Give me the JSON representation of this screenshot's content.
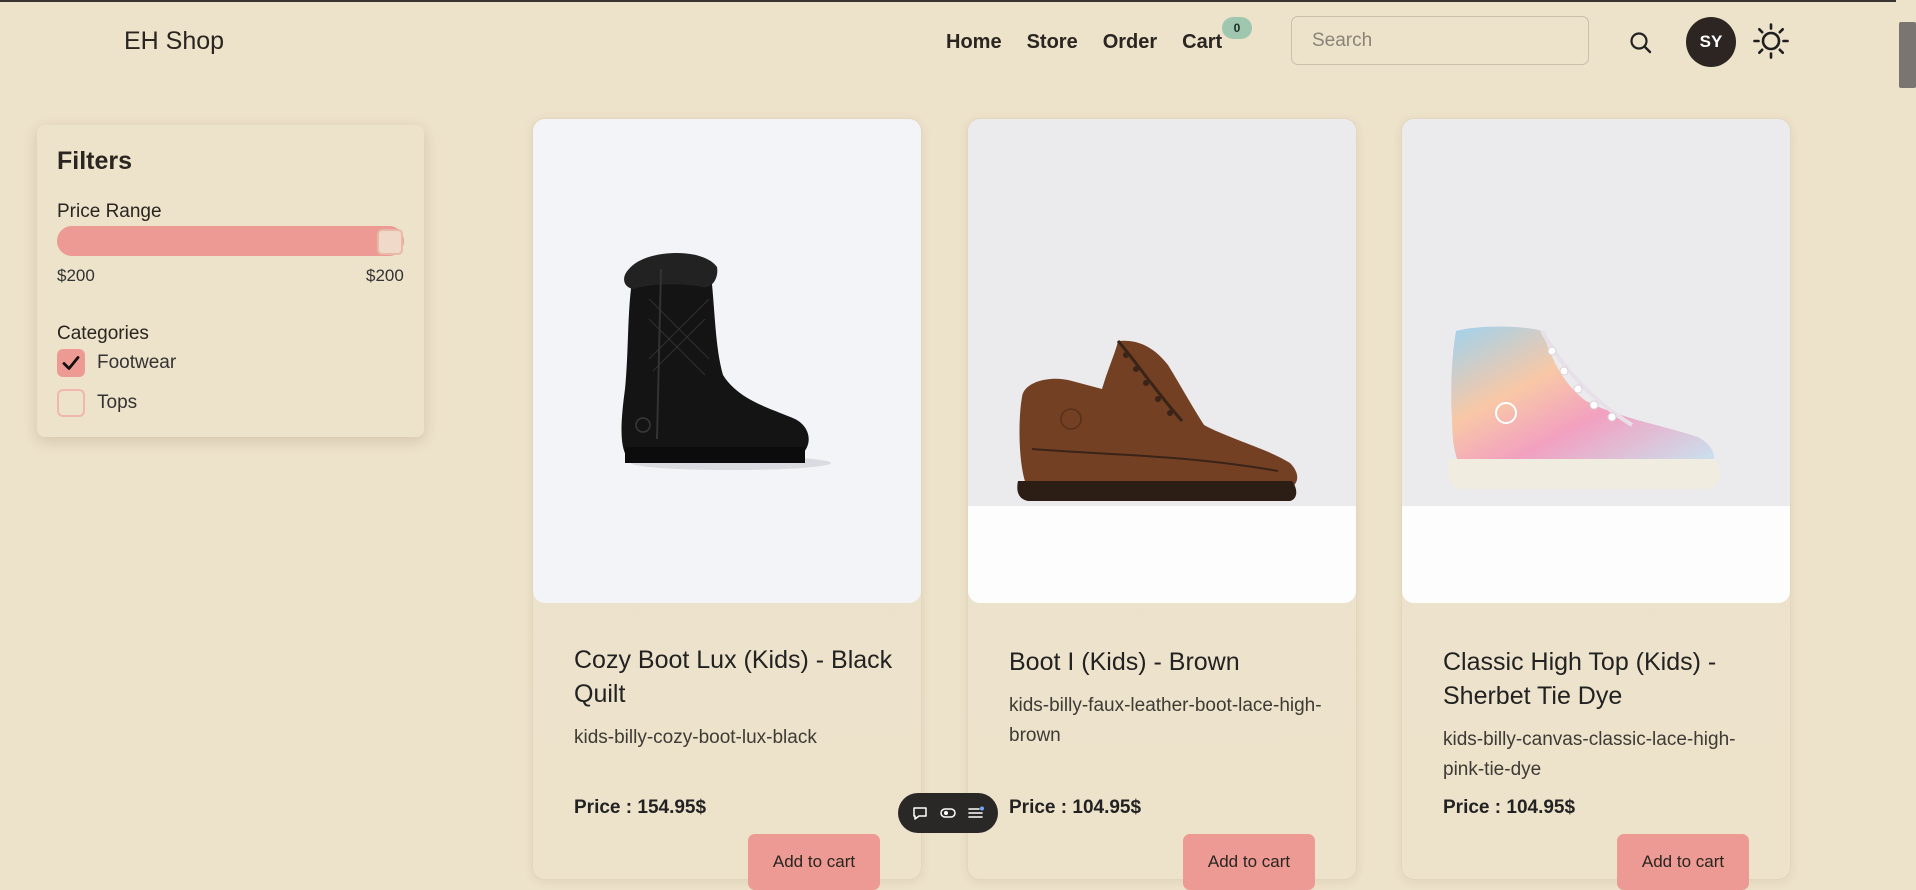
{
  "header": {
    "brand": "EH Shop",
    "nav": [
      {
        "label": "Home"
      },
      {
        "label": "Store"
      },
      {
        "label": "Order"
      },
      {
        "label": "Cart"
      }
    ],
    "cart_count": "0",
    "search_placeholder": "Search",
    "avatar_initials": "SY",
    "icons": [
      "search-icon",
      "sun-theme-icon"
    ]
  },
  "filters": {
    "title": "Filters",
    "price_range": {
      "label": "Price Range",
      "min_label": "$200",
      "max_label": "$200",
      "fill_fraction": 1.0
    },
    "categories": {
      "label": "Categories",
      "items": [
        {
          "label": "Footwear",
          "checked": true
        },
        {
          "label": "Tops",
          "checked": false
        }
      ]
    }
  },
  "products": [
    {
      "title": "Cozy Boot Lux (Kids) - Black Quilt",
      "slug": "kids-billy-cozy-boot-lux-black",
      "price_prefix": "Price : ",
      "price": "154.95$",
      "button": "Add to cart"
    },
    {
      "title": "Boot I (Kids) - Brown",
      "slug": "kids-billy-faux-leather-boot-lace-high-brown",
      "price_prefix": "Price : ",
      "price": "104.95$",
      "button": "Add to cart"
    },
    {
      "title": "Classic High Top (Kids) - Sherbet Tie Dye",
      "slug": "kids-billy-canvas-classic-lace-high-pink-tie-dye",
      "price_prefix": "Price : ",
      "price": "104.95$",
      "button": "Add to cart"
    }
  ],
  "float_toolbar": {
    "icons": [
      "chat-bubble-icon",
      "toggle-icon",
      "list-settings-icon"
    ]
  },
  "colors": {
    "background": "#ede2ca",
    "accent": "#ec9a93",
    "badge": "#9fc7b0",
    "avatar": "#2c2522"
  }
}
